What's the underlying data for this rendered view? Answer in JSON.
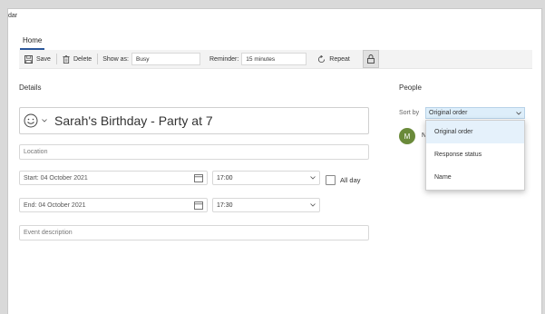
{
  "window": {
    "title": "dar"
  },
  "tabs": [
    {
      "label": "Home"
    }
  ],
  "toolbar": {
    "save_label": "Save",
    "delete_label": "Delete",
    "show_as_label": "Show as:",
    "show_as_value": "Busy",
    "reminder_label": "Reminder:",
    "reminder_value": "15 minutes",
    "repeat_label": "Repeat"
  },
  "details": {
    "heading": "Details",
    "event_title": "Sarah's Birthday - Party at 7",
    "location_placeholder": "Location",
    "start_date": "Start: 04 October 2021",
    "start_time": "17:00",
    "end_date": "End: 04 October 2021",
    "end_time": "17:30",
    "all_day_label": "All day",
    "description_placeholder": "Event description"
  },
  "people": {
    "heading": "People",
    "sort_by_label": "Sort by",
    "sort_value": "Original order",
    "attendee_initial": "M",
    "attendee_name": "N",
    "sort_options": [
      "Original order",
      "Response status",
      "Name"
    ]
  }
}
